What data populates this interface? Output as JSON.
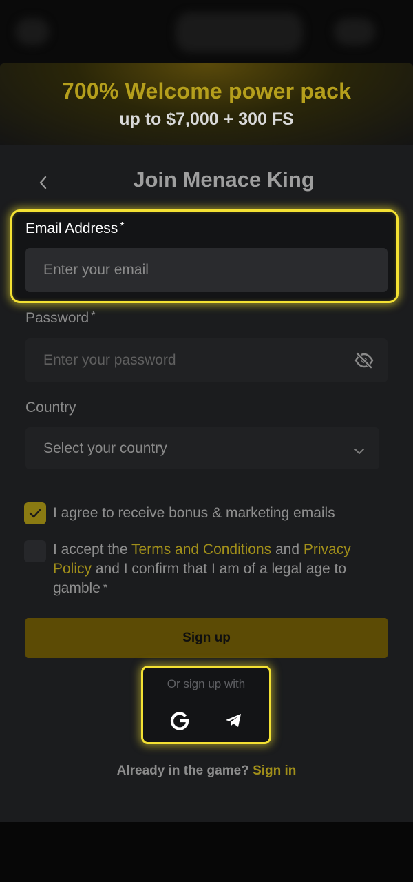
{
  "colors": {
    "accent": "#f3e133",
    "promo_title": "#b59f1c",
    "link": "#a18f1a",
    "signup_button": "#5c4b05",
    "modal_bg": "#1b1c1e"
  },
  "promo": {
    "title": "700% Welcome power pack",
    "subtitle": "up to $7,000 + 300 FS"
  },
  "header": {
    "back_icon": "chevron-left-icon",
    "title": "Join Menace King"
  },
  "form": {
    "email": {
      "label": "Email Address",
      "required_mark": "*",
      "placeholder": "Enter your email",
      "value": ""
    },
    "password": {
      "label": "Password",
      "required_mark": "*",
      "placeholder": "Enter your password",
      "value": "",
      "toggle_icon": "eye-off-icon"
    },
    "country": {
      "label": "Country",
      "selected": "Select your country",
      "arrow_icon": "chevron-down-icon"
    }
  },
  "consents": {
    "marketing": {
      "checked": true,
      "text": "I agree to receive bonus & marketing emails"
    },
    "terms": {
      "checked": false,
      "text_before": "I accept the ",
      "terms_link": "Terms and Conditions",
      "text_middle": " and ",
      "privacy_link": "Privacy Policy",
      "text_after": " and I confirm that I am of a legal age to gamble",
      "required_mark": "*"
    }
  },
  "actions": {
    "signup_label": "Sign up",
    "social_caption": "Or sign up with",
    "social": [
      {
        "name": "google-icon"
      },
      {
        "name": "telegram-icon"
      }
    ]
  },
  "footer": {
    "prompt": "Already in the game?",
    "signin_link": "Sign in"
  }
}
